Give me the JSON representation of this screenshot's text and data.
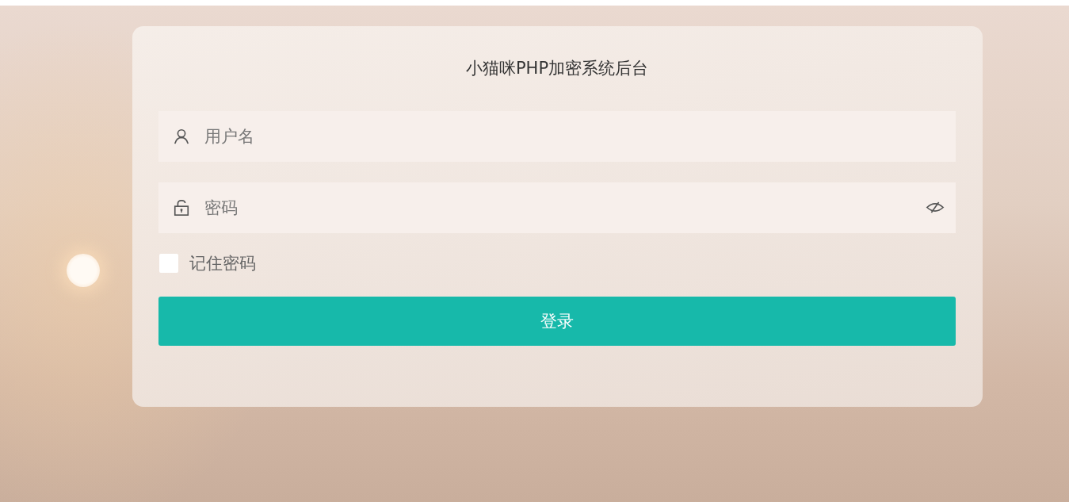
{
  "title": "小猫咪PHP加密系统后台",
  "fields": [
    {
      "kind": "username",
      "placeholder": "用户名"
    },
    {
      "kind": "password",
      "placeholder": "密码"
    }
  ],
  "remember": {
    "label": "记住密码",
    "checked": false
  },
  "login_button": {
    "label": "登录"
  }
}
